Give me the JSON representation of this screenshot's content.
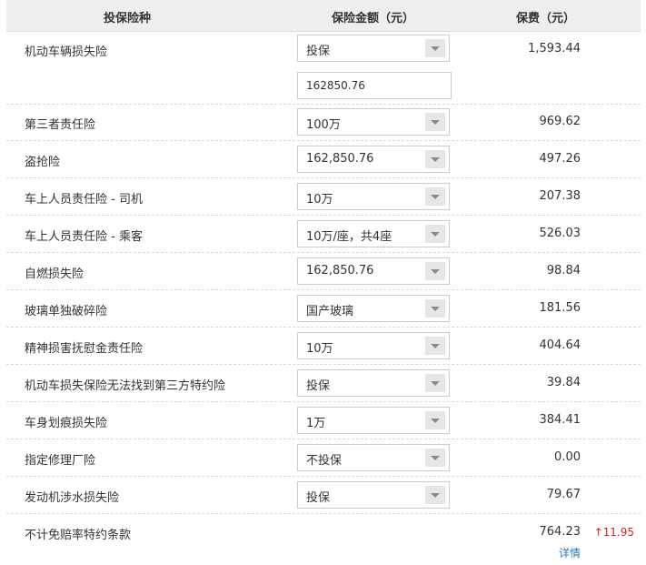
{
  "header": {
    "col_type": "投保险种",
    "col_amount": "保险金额（元）",
    "col_fee": "保费（元）"
  },
  "rows": [
    {
      "name": "机动车辆损失险",
      "select": "投保",
      "input": "162850.76",
      "fee": "1,593.44"
    },
    {
      "name": "第三者责任险",
      "select": "100万",
      "fee": "969.62"
    },
    {
      "name": "盗抢险",
      "select": "162,850.76",
      "fee": "497.26"
    },
    {
      "name": "车上人员责任险 - 司机",
      "select": "10万",
      "fee": "207.38"
    },
    {
      "name": "车上人员责任险 - 乘客",
      "select": "10万/座，共4座",
      "fee": "526.03"
    },
    {
      "name": "自燃损失险",
      "select": "162,850.76",
      "fee": "98.84"
    },
    {
      "name": "玻璃单独破碎险",
      "select": "国产玻璃",
      "fee": "181.56"
    },
    {
      "name": "精神损害抚慰金责任险",
      "select": "10万",
      "fee": "404.64"
    },
    {
      "name": "机动车损失保险无法找到第三方特约险",
      "select": "投保",
      "fee": "39.84"
    },
    {
      "name": "车身划痕损失险",
      "select": "1万",
      "fee": "384.41"
    },
    {
      "name": "指定修理厂险",
      "select": "不投保",
      "fee": "0.00"
    },
    {
      "name": "发动机涉水损失险",
      "select": "投保",
      "fee": "79.67"
    }
  ],
  "footer": {
    "name": "不计免赔率特约条款",
    "fee": "764.23",
    "diff": "↑11.95",
    "detail_link": "详情"
  },
  "colors": {
    "header_bg": "#eeeeee",
    "diff_red": "#e02020",
    "link_blue": "#2a7dbf"
  }
}
